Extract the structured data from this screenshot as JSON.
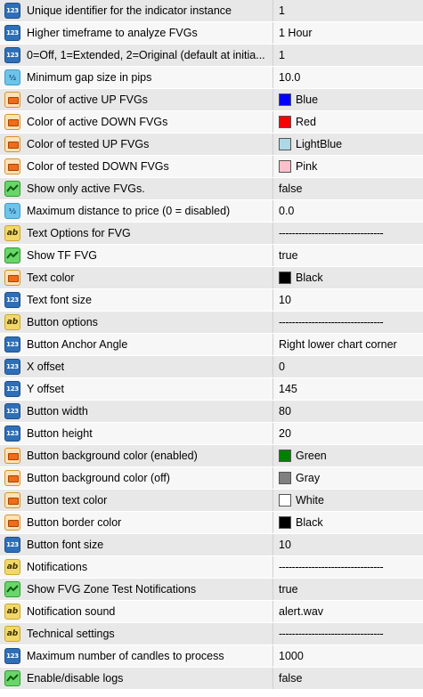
{
  "parameters": [
    {
      "type": "int",
      "icon": "int-type-icon",
      "name": "Unique identifier for the indicator instance",
      "value": "1"
    },
    {
      "type": "int",
      "icon": "int-type-icon",
      "name": "Higher timeframe to analyze FVGs",
      "value": "1 Hour"
    },
    {
      "type": "int",
      "icon": "int-type-icon",
      "name": "0=Off, 1=Extended, 2=Original (default at initia...",
      "value": "1"
    },
    {
      "type": "dbl",
      "icon": "double-type-icon",
      "name": "Minimum gap size in pips",
      "value": "10.0"
    },
    {
      "type": "clr",
      "icon": "color-type-icon",
      "name": "Color of active UP FVGs",
      "value": "Blue",
      "swatch": "#0000ff"
    },
    {
      "type": "clr",
      "icon": "color-type-icon",
      "name": "Color of active DOWN FVGs",
      "value": "Red",
      "swatch": "#ff0000"
    },
    {
      "type": "clr",
      "icon": "color-type-icon",
      "name": "Color of tested UP FVGs",
      "value": "LightBlue",
      "swatch": "#add8e6"
    },
    {
      "type": "clr",
      "icon": "color-type-icon",
      "name": "Color of tested DOWN FVGs",
      "value": "Pink",
      "swatch": "#ffc0cb"
    },
    {
      "type": "bool",
      "icon": "bool-type-icon",
      "name": "Show only active FVGs.",
      "value": "false"
    },
    {
      "type": "dbl",
      "icon": "double-type-icon",
      "name": "Maximum distance to price (0 = disabled)",
      "value": "0.0"
    },
    {
      "type": "str",
      "icon": "string-type-icon",
      "name": "Text Options for FVG",
      "value": "--------------------------------"
    },
    {
      "type": "bool",
      "icon": "bool-type-icon",
      "name": "Show TF FVG",
      "value": "true"
    },
    {
      "type": "clr",
      "icon": "color-type-icon",
      "name": "Text color",
      "value": "Black",
      "swatch": "#000000"
    },
    {
      "type": "int",
      "icon": "int-type-icon",
      "name": "Text font size",
      "value": "10"
    },
    {
      "type": "str",
      "icon": "string-type-icon",
      "name": "Button options",
      "value": "--------------------------------"
    },
    {
      "type": "int",
      "icon": "int-type-icon",
      "name": "Button Anchor Angle",
      "value": "Right lower chart corner"
    },
    {
      "type": "int",
      "icon": "int-type-icon",
      "name": "X offset",
      "value": "0"
    },
    {
      "type": "int",
      "icon": "int-type-icon",
      "name": "Y offset",
      "value": "145"
    },
    {
      "type": "int",
      "icon": "int-type-icon",
      "name": "Button width",
      "value": "80"
    },
    {
      "type": "int",
      "icon": "int-type-icon",
      "name": "Button height",
      "value": "20"
    },
    {
      "type": "clr",
      "icon": "color-type-icon",
      "name": "Button background color (enabled)",
      "value": "Green",
      "swatch": "#008000"
    },
    {
      "type": "clr",
      "icon": "color-type-icon",
      "name": "Button background color (off)",
      "value": "Gray",
      "swatch": "#808080"
    },
    {
      "type": "clr",
      "icon": "color-type-icon",
      "name": "Button text color",
      "value": "White",
      "swatch": "#ffffff"
    },
    {
      "type": "clr",
      "icon": "color-type-icon",
      "name": "Button border color",
      "value": "Black",
      "swatch": "#000000"
    },
    {
      "type": "int",
      "icon": "int-type-icon",
      "name": "Button font size",
      "value": "10"
    },
    {
      "type": "str",
      "icon": "string-type-icon",
      "name": "Notifications",
      "value": "--------------------------------"
    },
    {
      "type": "bool",
      "icon": "bool-type-icon",
      "name": "Show FVG Zone Test Notifications",
      "value": "true"
    },
    {
      "type": "str",
      "icon": "string-type-icon",
      "name": "Notification sound",
      "value": "alert.wav"
    },
    {
      "type": "str",
      "icon": "string-type-icon",
      "name": "Technical settings",
      "value": "--------------------------------"
    },
    {
      "type": "int",
      "icon": "int-type-icon",
      "name": "Maximum number of candles to process",
      "value": "1000"
    },
    {
      "type": "bool",
      "icon": "bool-type-icon",
      "name": "Enable/disable logs",
      "value": "false"
    }
  ],
  "icon_glyphs": {
    "int": "123",
    "dbl": "½",
    "str": "ab"
  }
}
